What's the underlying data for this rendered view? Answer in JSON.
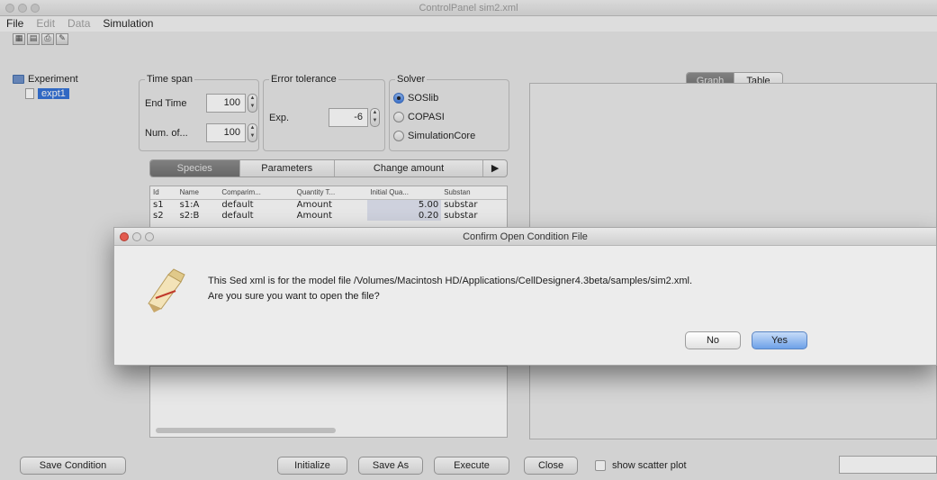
{
  "window": {
    "title": "ControlPanel sim2.xml"
  },
  "menu": {
    "file": "File",
    "edit": "Edit",
    "data": "Data",
    "simulation": "Simulation"
  },
  "toolbar": {
    "icons": [
      "grid-icon",
      "grid2-icon",
      "print-icon",
      "tool-icon"
    ]
  },
  "tree": {
    "root": "Experiment",
    "child": "expt1"
  },
  "time_span": {
    "title": "Time span",
    "end_time_label": "End Time",
    "end_time_value": "100",
    "num_label": "Num. of...",
    "num_value": "100"
  },
  "error_tolerance": {
    "title": "Error tolerance",
    "exp_label": "Exp.",
    "exp_value": "-6"
  },
  "solver": {
    "title": "Solver",
    "options": [
      "SOSlib",
      "COPASI",
      "SimulationCore"
    ],
    "selected": "SOSlib"
  },
  "left_tabs": [
    "Species",
    "Parameters",
    "Change amount"
  ],
  "left_tabs_more": "▶",
  "species_table": {
    "columns": [
      "Id",
      "Name",
      "Comparim...",
      "Quantity T...",
      "Initial Qua...",
      "Substan"
    ],
    "rows": [
      [
        "s1",
        "s1:A",
        "default",
        "Amount",
        "5.00",
        "substar"
      ],
      [
        "s2",
        "s2:B",
        "default",
        "Amount",
        "0.20",
        "substar"
      ]
    ]
  },
  "right_tabs": [
    "Graph",
    "Table"
  ],
  "bottom_buttons": {
    "save_condition": "Save Condition",
    "initialize": "Initialize",
    "save_as": "Save As",
    "execute": "Execute",
    "close": "Close",
    "scatter_label": "show scatter plot"
  },
  "dialog": {
    "title": "Confirm Open Condition File",
    "line1": "This Sed xml is for the model file /Volumes/Macintosh HD/Applications/CellDesigner4.3beta/samples/sim2.xml.",
    "line2": "Are you sure you want to open the file?",
    "no": "No",
    "yes": "Yes"
  }
}
